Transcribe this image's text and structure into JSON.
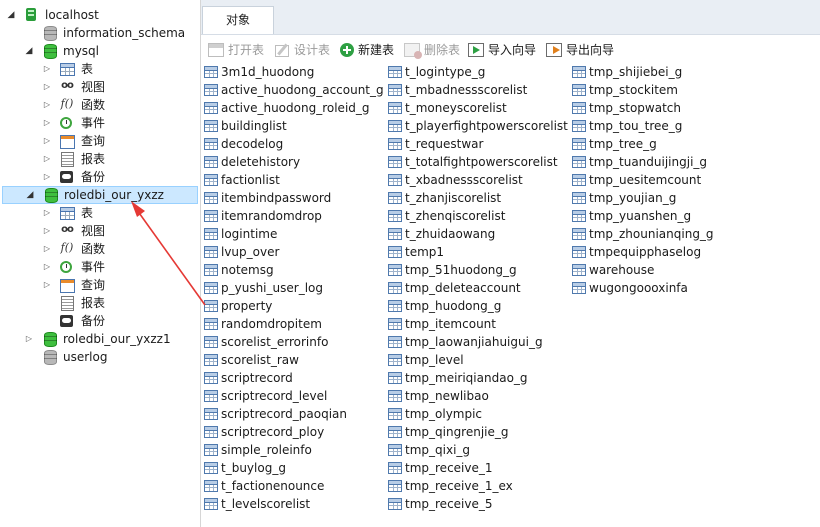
{
  "tree": {
    "connection": "localhost",
    "databases": [
      {
        "name": "information_schema",
        "state": "closed",
        "icon_color": "grey"
      },
      {
        "name": "mysql",
        "state": "open",
        "icon_color": "green"
      },
      {
        "name": "roledbi_our_yxzz",
        "state": "open",
        "icon_color": "green",
        "selected": true
      },
      {
        "name": "roledbi_our_yxzz1",
        "state": "collapsed",
        "icon_color": "green"
      },
      {
        "name": "userlog",
        "state": "closed",
        "icon_color": "grey"
      }
    ],
    "categories": [
      "表",
      "视图",
      "函数",
      "事件",
      "查询",
      "报表",
      "备份"
    ]
  },
  "tabs": [
    {
      "label": "对象",
      "active": true
    }
  ],
  "toolbar": {
    "open_table": "打开表",
    "design_table": "设计表",
    "new_table": "新建表",
    "delete_table": "删除表",
    "import_wizard": "导入向导",
    "export_wizard": "导出向导"
  },
  "tables": {
    "col1": [
      "3m1d_huodong",
      "active_huodong_account_g",
      "active_huodong_roleid_g",
      "buildinglist",
      "decodelog",
      "deletehistory",
      "factionlist",
      "itembindpassword",
      "itemrandomdrop",
      "logintime",
      "lvup_over",
      "notemsg",
      "p_yushi_user_log",
      "property",
      "randomdropitem",
      "scorelist_errorinfo",
      "scorelist_raw",
      "scriptrecord",
      "scriptrecord_level",
      "scriptrecord_paoqian",
      "scriptrecord_ploy",
      "simple_roleinfo",
      "t_buylog_g",
      "t_factionenounce",
      "t_levelscorelist"
    ],
    "col2": [
      "t_logintype_g",
      "t_mbadnessscorelist",
      "t_moneyscorelist",
      "t_playerfightpowerscorelist",
      "t_requestwar",
      "t_totalfightpowerscorelist",
      "t_xbadnessscorelist",
      "t_zhanjiscorelist",
      "t_zhenqiscorelist",
      "t_zhuidaowang",
      "temp1",
      "tmp_51huodong_g",
      "tmp_deleteaccount",
      "tmp_huodong_g",
      "tmp_itemcount",
      "tmp_laowanjiahuigui_g",
      "tmp_level",
      "tmp_meiriqiandao_g",
      "tmp_newlibao",
      "tmp_olympic",
      "tmp_qingrenjie_g",
      "tmp_qixi_g",
      "tmp_receive_1",
      "tmp_receive_1_ex",
      "tmp_receive_5"
    ],
    "col3": [
      "tmp_shijiebei_g",
      "tmp_stockitem",
      "tmp_stopwatch",
      "tmp_tou_tree_g",
      "tmp_tree_g",
      "tmp_tuanduijingji_g",
      "tmp_uesitemcount",
      "tmp_youjian_g",
      "tmp_yuanshen_g",
      "tmp_zhounianqing_g",
      "tmpequipphaselog",
      "warehouse",
      "wugongoooxinfa"
    ]
  },
  "colors": {
    "selection": "#cce8ff",
    "annotation_arrow": "#e53935",
    "tab_bar": "#e9eef4"
  }
}
